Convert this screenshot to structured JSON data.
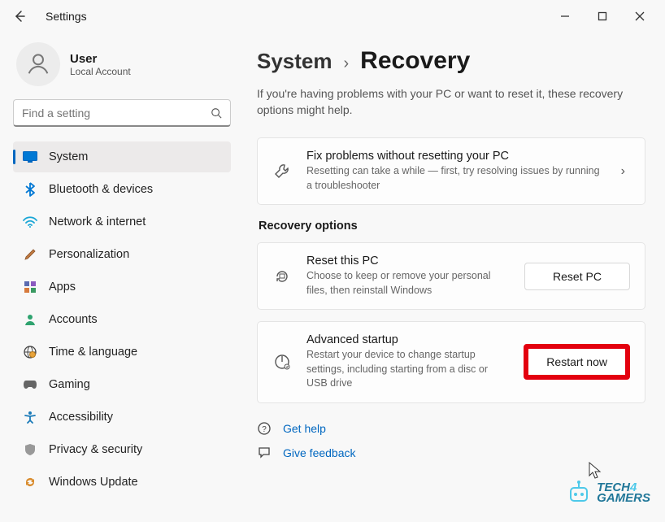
{
  "window": {
    "title": "Settings"
  },
  "user": {
    "name": "User",
    "account_type": "Local Account"
  },
  "search": {
    "placeholder": "Find a setting"
  },
  "sidebar": {
    "items": [
      {
        "label": "System",
        "icon": "monitor"
      },
      {
        "label": "Bluetooth & devices",
        "icon": "bluetooth"
      },
      {
        "label": "Network & internet",
        "icon": "wifi"
      },
      {
        "label": "Personalization",
        "icon": "brush"
      },
      {
        "label": "Apps",
        "icon": "apps"
      },
      {
        "label": "Accounts",
        "icon": "person"
      },
      {
        "label": "Time & language",
        "icon": "globe"
      },
      {
        "label": "Gaming",
        "icon": "gaming"
      },
      {
        "label": "Accessibility",
        "icon": "accessibility"
      },
      {
        "label": "Privacy & security",
        "icon": "shield"
      },
      {
        "label": "Windows Update",
        "icon": "update"
      }
    ]
  },
  "breadcrumb": {
    "parent": "System",
    "current": "Recovery"
  },
  "page_desc": "If you're having problems with your PC or want to reset it, these recovery options might help.",
  "cards": {
    "fix": {
      "title": "Fix problems without resetting your PC",
      "sub": "Resetting can take a while — first, try resolving issues by running a troubleshooter"
    },
    "section_heading": "Recovery options",
    "reset": {
      "title": "Reset this PC",
      "sub": "Choose to keep or remove your personal files, then reinstall Windows",
      "button": "Reset PC"
    },
    "advanced": {
      "title": "Advanced startup",
      "sub": "Restart your device to change startup settings, including starting from a disc or USB drive",
      "button": "Restart now"
    }
  },
  "help": {
    "get_help": "Get help",
    "feedback": "Give feedback"
  },
  "watermark": {
    "brand1": "TECH",
    "brand2": "4",
    "brand3": "GAMERS"
  }
}
